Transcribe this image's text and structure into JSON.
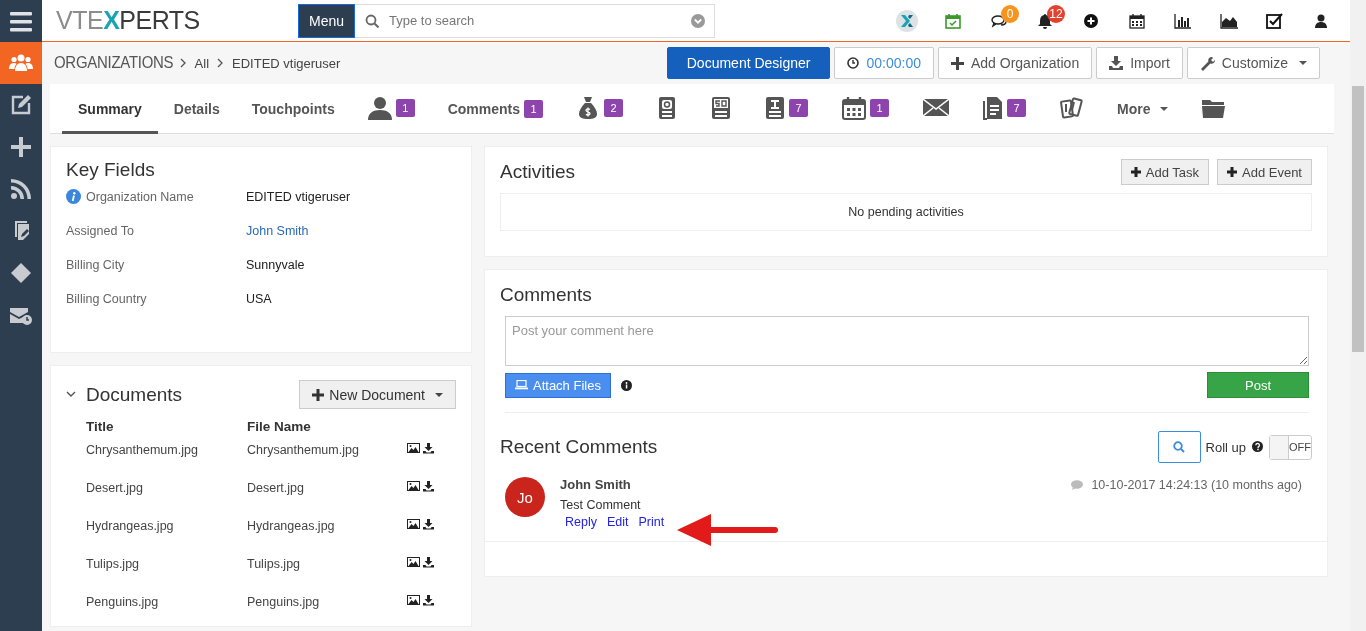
{
  "sidebar": {
    "items": [
      {
        "selected": true
      },
      {
        "selected": false
      },
      {
        "selected": false
      },
      {
        "selected": false
      },
      {
        "selected": false
      },
      {
        "selected": false
      },
      {
        "selected": false
      }
    ]
  },
  "topbar": {
    "logo_parts": [
      "VTE",
      "X",
      "PERTS"
    ],
    "menu_button": "Menu",
    "search": {
      "placeholder": "Type to search"
    },
    "chat_badge": {
      "text": "0",
      "color": "#f7941d"
    },
    "bell_badge": {
      "text": "12",
      "color": "#e2412e"
    }
  },
  "breadcrumb": {
    "module": "ORGANIZATIONS",
    "items": [
      "All",
      "EDITED vtigeruser"
    ]
  },
  "actions": [
    {
      "kind": "primary",
      "label": "Document Designer"
    },
    {
      "kind": "timer",
      "label": "00:00:00"
    },
    {
      "kind": "add",
      "label": "Add Organization"
    },
    {
      "kind": "import",
      "label": "Import"
    },
    {
      "kind": "dropdown",
      "label": "Customize"
    }
  ],
  "tabs": [
    {
      "kind": "text",
      "label": "Summary",
      "selected": true
    },
    {
      "kind": "text",
      "label": "Details",
      "selected": false
    },
    {
      "kind": "text",
      "label": "Touchpoints",
      "selected": false
    },
    {
      "kind": "icon",
      "badge": "1",
      "selected": false
    },
    {
      "kind": "text",
      "label": "Comments",
      "badge": "1",
      "selected": false
    },
    {
      "kind": "icon",
      "badge": "2",
      "selected": false
    },
    {
      "kind": "icon",
      "selected": false
    },
    {
      "kind": "icon",
      "selected": false
    },
    {
      "kind": "icon",
      "badge": "7",
      "selected": false
    },
    {
      "kind": "icon",
      "badge": "1",
      "selected": false
    },
    {
      "kind": "icon",
      "selected": false
    },
    {
      "kind": "icon",
      "badge": "7",
      "selected": false
    },
    {
      "kind": "icon",
      "selected": false
    },
    {
      "kind": "menu",
      "label": "More",
      "selected": false
    },
    {
      "kind": "icon",
      "selected": false
    }
  ],
  "key_fields": {
    "title": "Key Fields",
    "fields": [
      {
        "label": "Organization Name",
        "value": "EDITED vtigeruser",
        "kind": "text",
        "info": true
      },
      {
        "label": "Assigned To",
        "value": "John Smith",
        "kind": "link",
        "info": false
      },
      {
        "label": "Billing City",
        "value": "Sunnyvale",
        "kind": "text",
        "info": false
      },
      {
        "label": "Billing Country",
        "value": "USA",
        "kind": "text",
        "info": false
      }
    ]
  },
  "documents": {
    "title": "Documents",
    "expanded": true,
    "new_button": "New Document",
    "columns": [
      "Title",
      "File Name"
    ],
    "rows": [
      {
        "title": "Chrysanthemum.jpg",
        "file_name": "Chrysanthemum.jpg"
      },
      {
        "title": "Desert.jpg",
        "file_name": "Desert.jpg"
      },
      {
        "title": "Hydrangeas.jpg",
        "file_name": "Hydrangeas.jpg"
      },
      {
        "title": "Tulips.jpg",
        "file_name": "Tulips.jpg"
      },
      {
        "title": "Penguins.jpg",
        "file_name": "Penguins.jpg"
      }
    ]
  },
  "activities": {
    "title": "Activities",
    "buttons": [
      "Add Task",
      "Add Event"
    ],
    "empty_text": "No pending activities"
  },
  "comments": {
    "title": "Comments",
    "placeholder": "Post your comment here",
    "attach_button": "Attach Files",
    "post_button": "Post",
    "recent_title": "Recent Comments",
    "roll_up": {
      "label": "Roll up",
      "on": false,
      "state_text": "OFF"
    },
    "items": [
      {
        "initials": "Jo",
        "author": "John Smith",
        "text": "Test Comment",
        "time": "10-10-2017 14:24:13 (10 months ago)",
        "actions": [
          "Reply",
          "Edit",
          "Print"
        ]
      }
    ]
  }
}
